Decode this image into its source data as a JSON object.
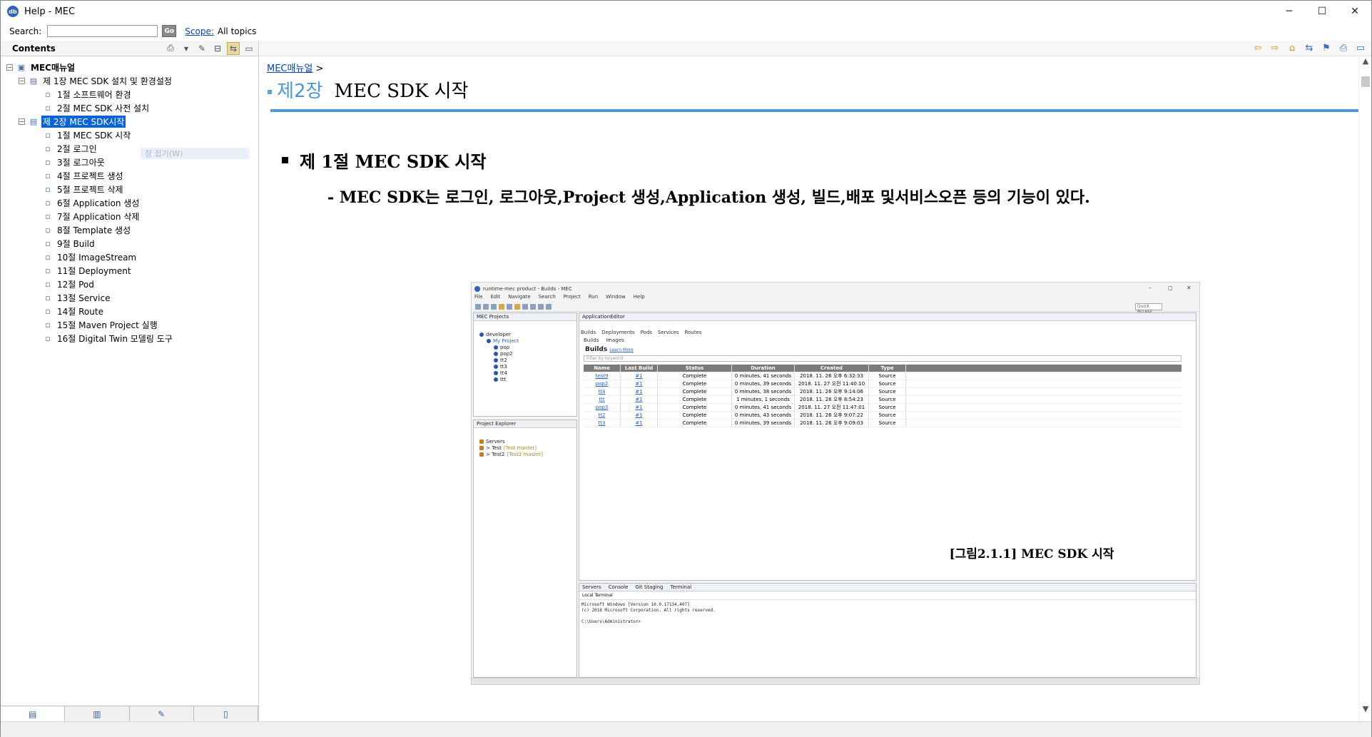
{
  "window": {
    "title": "Help - MEC",
    "controls": [
      "─",
      "☐",
      "✕"
    ]
  },
  "search": {
    "label": "Search:",
    "value": "",
    "go_label": "Go",
    "scope_label": "Scope:",
    "scope_value": "All topics"
  },
  "left_pane": {
    "title": "Contents",
    "tree": [
      {
        "level": 0,
        "expander": "−",
        "icon": "book-icon",
        "label": "MEC매뉴얼",
        "bold": true
      },
      {
        "level": 1,
        "expander": "−",
        "icon": "book-open-icon",
        "label": "제 1장 MEC SDK 설치 및 환경설정"
      },
      {
        "level": 2,
        "expander": "",
        "icon": "page-icon",
        "label": "1절 소프트웨어 환경"
      },
      {
        "level": 2,
        "expander": "",
        "icon": "page-icon",
        "label": "2절 MEC SDK 사전 설치"
      },
      {
        "level": 1,
        "expander": "−",
        "icon": "book-open-icon",
        "label": "제 2장 MEC SDK시작",
        "selected": true
      },
      {
        "level": 2,
        "expander": "",
        "icon": "page-icon",
        "label": "1절 MEC SDK 시작"
      },
      {
        "level": 2,
        "expander": "",
        "icon": "page-icon",
        "label": "2절 로그인"
      },
      {
        "level": 2,
        "expander": "",
        "icon": "page-icon",
        "label": "3절 로그아웃"
      },
      {
        "level": 2,
        "expander": "",
        "icon": "page-icon",
        "label": "4절 프로젝트 생성"
      },
      {
        "level": 2,
        "expander": "",
        "icon": "page-icon",
        "label": "5절 프로젝트 삭제"
      },
      {
        "level": 2,
        "expander": "",
        "icon": "page-icon",
        "label": "6절 Application 생성"
      },
      {
        "level": 2,
        "expander": "",
        "icon": "page-icon",
        "label": "7절 Application 삭제"
      },
      {
        "level": 2,
        "expander": "",
        "icon": "page-icon",
        "label": "8절 Template 생성"
      },
      {
        "level": 2,
        "expander": "",
        "icon": "page-icon",
        "label": "9절 Build"
      },
      {
        "level": 2,
        "expander": "",
        "icon": "page-icon",
        "label": "10절 ImageStream"
      },
      {
        "level": 2,
        "expander": "",
        "icon": "page-icon",
        "label": "11절 Deployment"
      },
      {
        "level": 2,
        "expander": "",
        "icon": "page-icon",
        "label": "12절 Pod"
      },
      {
        "level": 2,
        "expander": "",
        "icon": "page-icon",
        "label": "13절 Service"
      },
      {
        "level": 2,
        "expander": "",
        "icon": "page-icon",
        "label": "14절 Route"
      },
      {
        "level": 2,
        "expander": "",
        "icon": "page-icon",
        "label": "15절 Maven Project 실행"
      },
      {
        "level": 2,
        "expander": "",
        "icon": "page-icon",
        "label": "16절 Digital Twin 모델링 도구"
      }
    ],
    "ghost_tooltip": "창 접기(W)",
    "bottom_tabs": [
      "contents-tab-icon",
      "index-tab-icon",
      "search-tab-icon",
      "bookmarks-tab-icon"
    ]
  },
  "document": {
    "breadcrumb": "MEC매뉴얼",
    "breadcrumb_sep": ">",
    "chapter_number": "제2장",
    "chapter_title": "MEC SDK 시작",
    "section_heading": "제 1절 MEC SDK 시작",
    "description": "- MEC SDK는 로그인, 로그아웃,Project 생성,Application 생성, 빌드,배포 및서비스오픈 등의 기능이 있다.",
    "figure_caption": "[그림2.1.1] MEC SDK 시작"
  },
  "figure": {
    "title": "runtime-mec product - Builds - MEC",
    "menu": [
      "File",
      "Edit",
      "Navigate",
      "Search",
      "Project",
      "Run",
      "Window",
      "Help"
    ],
    "quick_access": "Quick Access",
    "projects_panel": {
      "title": "MEC Projects",
      "items": [
        {
          "label": "developer",
          "indent": 0
        },
        {
          "label": "My Project",
          "indent": 1
        },
        {
          "label": "pop",
          "indent": 2
        },
        {
          "label": "pop2",
          "indent": 2
        },
        {
          "label": "tt2",
          "indent": 2
        },
        {
          "label": "tt3",
          "indent": 2
        },
        {
          "label": "tt4",
          "indent": 2
        },
        {
          "label": "ttt",
          "indent": 2
        }
      ]
    },
    "explorer_panel": {
      "title": "Project Explorer",
      "items": [
        {
          "label": "Servers",
          "note": ""
        },
        {
          "label": "> Test",
          "note": "[Test master]"
        },
        {
          "label": "> Test2",
          "note": "[Test2 master]"
        }
      ]
    },
    "editor": {
      "tab": "ApplicationEditor",
      "subtabs": [
        "Builds",
        "Deployments",
        "Pods",
        "Services",
        "Routes"
      ],
      "filter_tabs": [
        "Builds",
        "Images"
      ],
      "builds_title": "Builds",
      "builds_link": "Learn More",
      "filter_placeholder": "Filter by keyword",
      "columns": [
        "Name",
        "Last Build",
        "Status",
        "Duration",
        "Created",
        "Type"
      ],
      "rows": [
        [
          "test9",
          "#1",
          "Complete",
          "0 minutes, 41 seconds",
          "2018. 11. 26 오후 6:32:33",
          "Source"
        ],
        [
          "pop2",
          "#1",
          "Complete",
          "0 minutes, 39 seconds",
          "2018. 11. 27 오전 11:40:10",
          "Source"
        ],
        [
          "tt4",
          "#1",
          "Complete",
          "0 minutes, 38 seconds",
          "2018. 11. 26 오후 9:14:06",
          "Source"
        ],
        [
          "ttt",
          "#1",
          "Complete",
          "1 minutes, 1 seconds",
          "2018. 11. 26 오후 8:54:23",
          "Source"
        ],
        [
          "pop3",
          "#1",
          "Complete",
          "0 minutes, 41 seconds",
          "2018. 11. 27 오전 11:47:01",
          "Source"
        ],
        [
          "tt2",
          "#1",
          "Complete",
          "0 minutes, 43 seconds",
          "2018. 11. 26 오후 9:07:22",
          "Source"
        ],
        [
          "tt3",
          "#1",
          "Complete",
          "0 minutes, 39 seconds",
          "2018. 11. 26 오후 9:09:03",
          "Source"
        ]
      ]
    },
    "console": {
      "tabs": [
        "Servers",
        "Console",
        "Git Staging",
        "Terminal"
      ],
      "terminal_tab": "Local Terminal",
      "lines": [
        "Microsoft Windows [Version 10.0.17134.407]",
        "(c) 2018 Microsoft Corporation. All rights reserved.",
        "",
        "C:\\Users\\Administrator>"
      ]
    }
  },
  "colors": {
    "accent": "#4a9ae0",
    "selection": "#0a64d8",
    "link": "#0645ad"
  }
}
